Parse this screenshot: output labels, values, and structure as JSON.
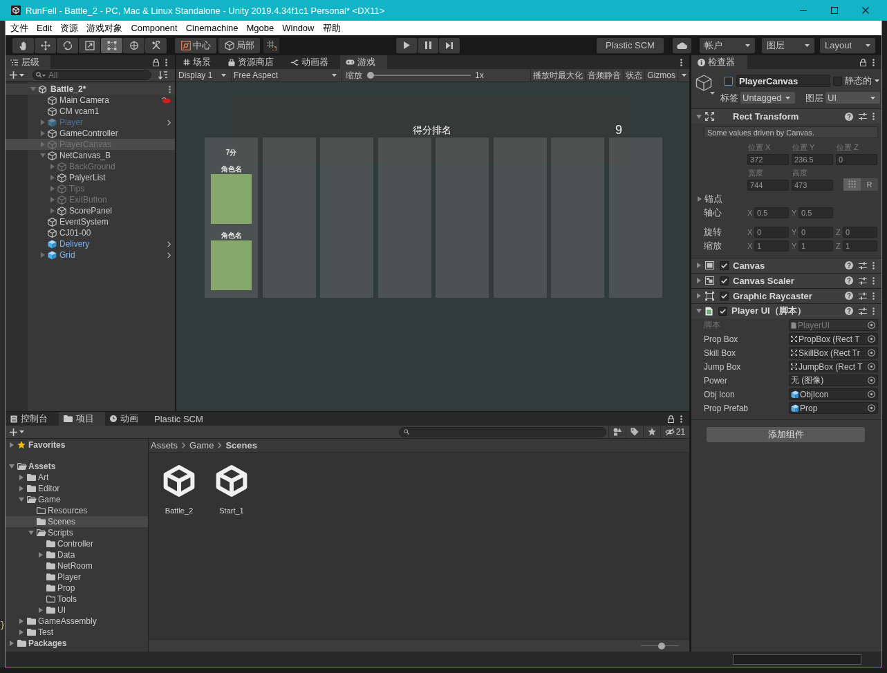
{
  "background_window": {
    "fragment": "}"
  },
  "window": {
    "title": "RunFell - Battle_2 - PC, Mac & Linux Standalone - Unity 2019.4.34f1c1 Personal* <DX11>"
  },
  "menu": [
    "文件",
    "Edit",
    "资源",
    "游戏对象",
    "Component",
    "Cinemachine",
    "Mgobe",
    "Window",
    "帮助"
  ],
  "toolbar": {
    "tools": [
      {
        "kind": "hand",
        "selected": false
      },
      {
        "kind": "move",
        "selected": false
      },
      {
        "kind": "rotate",
        "selected": false
      },
      {
        "kind": "scale",
        "selected": false
      },
      {
        "kind": "rect",
        "selected": true
      },
      {
        "kind": "transform",
        "selected": false
      },
      {
        "kind": "custom",
        "selected": false
      }
    ],
    "pivot_mode": "中心",
    "pivot_rotation": "局部",
    "plastic_scm": "Plastic SCM",
    "account": "帐户",
    "layers": "图层",
    "layout": "Layout"
  },
  "hierarchy": {
    "tab": "层级",
    "search": {
      "placeholder": "All"
    },
    "tree": [
      {
        "name": "Battle_2*",
        "kind": "scene",
        "active": true,
        "selected": false,
        "marker": false,
        "expanded": true,
        "children": [
          {
            "name": "Main Camera",
            "kind": "object",
            "active": true,
            "selected": false,
            "marker": true
          },
          {
            "name": "CM vcam1",
            "kind": "object",
            "active": true,
            "selected": false,
            "marker": false
          },
          {
            "name": "Player",
            "kind": "prefab",
            "active": false,
            "selected": false,
            "marker": false,
            "expanded": false
          },
          {
            "name": "GameController",
            "kind": "object",
            "active": true,
            "selected": false,
            "marker": false,
            "expanded": false
          },
          {
            "name": "PlayerCanvas",
            "kind": "object",
            "active": false,
            "selected": true,
            "marker": false,
            "expanded": false
          },
          {
            "name": "NetCanvas_B",
            "kind": "object",
            "active": true,
            "selected": false,
            "marker": false,
            "expanded": true,
            "children": [
              {
                "name": "BackGround",
                "kind": "object",
                "active": false,
                "selected": false,
                "marker": false,
                "expanded": false
              },
              {
                "name": "PalyerList",
                "kind": "object",
                "active": true,
                "selected": false,
                "marker": false,
                "expanded": false
              },
              {
                "name": "Tips",
                "kind": "object",
                "active": false,
                "selected": false,
                "marker": false,
                "expanded": false
              },
              {
                "name": "ExitButton",
                "kind": "object",
                "active": false,
                "selected": false,
                "marker": false,
                "expanded": false
              },
              {
                "name": "ScorePanel",
                "kind": "object",
                "active": true,
                "selected": false,
                "marker": false,
                "expanded": false
              }
            ]
          },
          {
            "name": "EventSystem",
            "kind": "object",
            "active": true,
            "selected": false,
            "marker": false
          },
          {
            "name": "CJ01-00",
            "kind": "object",
            "active": true,
            "selected": false,
            "marker": false
          },
          {
            "name": "Delivery",
            "kind": "prefab",
            "active": true,
            "selected": false,
            "marker": false
          },
          {
            "name": "Grid",
            "kind": "prefab",
            "active": true,
            "selected": false,
            "marker": false,
            "expanded": false
          }
        ]
      }
    ]
  },
  "game_view": {
    "tabs": [
      {
        "label": "场景",
        "kind": "scene",
        "selected": false
      },
      {
        "label": "资源商店",
        "kind": "store",
        "selected": false
      },
      {
        "label": "动画器",
        "kind": "animator",
        "selected": false
      },
      {
        "label": "游戏",
        "kind": "game",
        "selected": true
      }
    ],
    "toolbar": {
      "display": "Display 1",
      "aspect": "Free Aspect",
      "scale_label": "缩放",
      "scale": {
        "level": 0,
        "reading": "1x"
      },
      "toggles": [
        {
          "label": "播放时最大化",
          "on": false
        },
        {
          "label": "音频静音",
          "on": false
        },
        {
          "label": "状态",
          "on": false
        },
        {
          "label": "Gizmos",
          "on": false
        }
      ]
    },
    "score_panel": {
      "title": "得分排名",
      "count": "9",
      "columns": [
        {
          "kind": "ranked",
          "score": "7分",
          "players": [
            {
              "name": "角色名"
            },
            {
              "name": "角色名"
            }
          ]
        },
        {
          "kind": "empty"
        },
        {
          "kind": "empty"
        },
        {
          "kind": "empty"
        },
        {
          "kind": "empty"
        },
        {
          "kind": "empty"
        },
        {
          "kind": "empty"
        },
        {
          "kind": "empty"
        }
      ]
    }
  },
  "inspector": {
    "tab": "检查器",
    "object": {
      "active": false,
      "name": "PlayerCanvas",
      "static": false,
      "static_label": "静态的",
      "tag_label": "标签",
      "tag": "Untagged",
      "layer_label": "图层",
      "layer": "UI"
    },
    "components": [
      {
        "kind": "rect-transform",
        "title": "Rect Transform",
        "expanded": true,
        "note": "Some values driven by Canvas.",
        "position": [
          {
            "label": "位置 X",
            "value": "372"
          },
          {
            "label": "位置 Y",
            "value": "236.5"
          },
          {
            "label": "位置 Z",
            "value": "0"
          }
        ],
        "size": [
          {
            "label": "宽度",
            "value": "744"
          },
          {
            "label": "高度",
            "value": "473"
          }
        ],
        "edit_modes": [
          {
            "kind": "blueprint",
            "selected": true
          },
          {
            "kind": "raw",
            "label": "R",
            "selected": false
          }
        ],
        "anchors": {
          "label": "锚点",
          "expanded": false
        },
        "vectors": [
          {
            "label": "轴心",
            "values": [
              {
                "axis": "X",
                "value": "0.5"
              },
              {
                "axis": "Y",
                "value": "0.5"
              }
            ]
          },
          {
            "label": "旋转",
            "values": [
              {
                "axis": "X",
                "value": "0"
              },
              {
                "axis": "Y",
                "value": "0"
              },
              {
                "axis": "Z",
                "value": "0"
              }
            ]
          },
          {
            "label": "缩放",
            "values": [
              {
                "axis": "X",
                "value": "1"
              },
              {
                "axis": "Y",
                "value": "1"
              },
              {
                "axis": "Z",
                "value": "1"
              }
            ]
          }
        ]
      },
      {
        "kind": "canvas",
        "title": "Canvas",
        "enabled": true,
        "expanded": false
      },
      {
        "kind": "canvas-scaler",
        "title": "Canvas Scaler",
        "enabled": true,
        "expanded": false
      },
      {
        "kind": "raycaster",
        "title": "Graphic Raycaster",
        "enabled": true,
        "expanded": false
      },
      {
        "kind": "script",
        "title": "Player UI（脚本）",
        "enabled": true,
        "expanded": true,
        "fields": [
          {
            "label": "脚本",
            "kind": "script",
            "value": "PlayerUI",
            "disabled": true
          },
          {
            "label": "Prop Box",
            "kind": "rect-transform",
            "value": "PropBox (Rect T",
            "disabled": false
          },
          {
            "label": "Skill Box",
            "kind": "rect-transform",
            "value": "SkillBox (Rect Tr",
            "disabled": false
          },
          {
            "label": "Jump Box",
            "kind": "rect-transform",
            "value": "JumpBox (Rect T",
            "disabled": false
          },
          {
            "label": "Power",
            "kind": "none",
            "value": "无 (图像)",
            "disabled": false
          },
          {
            "label": "Obj Icon",
            "kind": "prefab",
            "value": "ObjIcon",
            "disabled": false
          },
          {
            "label": "Prop Prefab",
            "kind": "prefab",
            "value": "Prop",
            "disabled": false
          }
        ]
      }
    ],
    "add_component": "添加组件"
  },
  "project": {
    "tabs": [
      {
        "label": "控制台",
        "kind": "console",
        "selected": false
      },
      {
        "label": "项目",
        "kind": "project",
        "selected": true
      },
      {
        "label": "动画",
        "kind": "animation",
        "selected": false
      },
      {
        "label": "Plastic SCM",
        "kind": "plain",
        "selected": false
      }
    ],
    "hidden_count": "21",
    "tree": [
      {
        "name": "Favorites",
        "kind": "favorites",
        "expanded": false,
        "selected": false
      },
      {
        "name": "Assets",
        "kind": "root",
        "expanded": true,
        "selected": false,
        "children": [
          {
            "name": "Art",
            "kind": "folder",
            "expanded": false,
            "selected": false
          },
          {
            "name": "Editor",
            "kind": "folder",
            "expanded": false,
            "selected": false
          },
          {
            "name": "Game",
            "kind": "folder",
            "expanded": true,
            "selected": false,
            "children": [
              {
                "name": "Resources",
                "kind": "empty-folder",
                "selected": false
              },
              {
                "name": "Scenes",
                "kind": "folder",
                "selected": true
              },
              {
                "name": "Scripts",
                "kind": "folder",
                "expanded": true,
                "selected": false,
                "children": [
                  {
                    "name": "Controller",
                    "kind": "folder",
                    "selected": false
                  },
                  {
                    "name": "Data",
                    "kind": "folder",
                    "expanded": false,
                    "selected": false
                  },
                  {
                    "name": "NetRoom",
                    "kind": "folder",
                    "selected": false
                  },
                  {
                    "name": "Player",
                    "kind": "folder",
                    "selected": false
                  },
                  {
                    "name": "Prop",
                    "kind": "folder",
                    "selected": false
                  },
                  {
                    "name": "Tools",
                    "kind": "empty-folder",
                    "selected": false
                  },
                  {
                    "name": "UI",
                    "kind": "folder",
                    "expanded": false,
                    "selected": false
                  }
                ]
              }
            ]
          },
          {
            "name": "GameAssembly",
            "kind": "folder",
            "expanded": false,
            "selected": false
          },
          {
            "name": "Test",
            "kind": "folder",
            "expanded": false,
            "selected": false
          }
        ]
      },
      {
        "name": "Packages",
        "kind": "root",
        "expanded": false,
        "selected": false
      }
    ],
    "breadcrumb": [
      "Assets",
      "Game",
      "Scenes"
    ],
    "assets": [
      {
        "name": "Battle_2",
        "kind": "scene"
      },
      {
        "name": "Start_1",
        "kind": "scene"
      }
    ],
    "icon_size": {
      "level": 0.56
    }
  }
}
